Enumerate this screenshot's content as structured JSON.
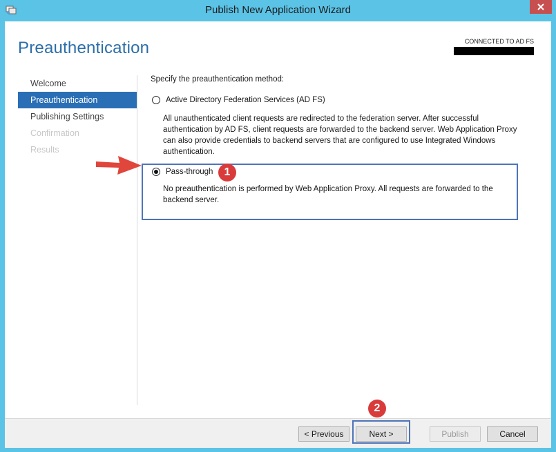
{
  "window": {
    "title": "Publish New Application Wizard",
    "icon": "wizard-app-icon"
  },
  "header": {
    "page_title": "Preauthentication",
    "connected_label": "CONNECTED TO AD FS"
  },
  "nav": {
    "items": [
      {
        "label": "Welcome",
        "state": "normal"
      },
      {
        "label": "Preauthentication",
        "state": "active"
      },
      {
        "label": "Publishing Settings",
        "state": "normal"
      },
      {
        "label": "Confirmation",
        "state": "disabled"
      },
      {
        "label": "Results",
        "state": "disabled"
      }
    ]
  },
  "content": {
    "prompt": "Specify the preauthentication method:",
    "option_adfs": {
      "label": "Active Directory Federation Services (AD FS)",
      "selected": false,
      "description_lines": [
        "All unauthenticated client requests are redirected to the federation server. After successful",
        "authentication by AD FS, client requests are forwarded to the backend server. Web Application Proxy",
        "can also provide credentials to backend servers that are configured to use Integrated Windows",
        "authentication."
      ]
    },
    "option_passthrough": {
      "label": "Pass-through",
      "selected": true,
      "description_lines": [
        "No preauthentication is performed by Web Application Proxy. All requests are forwarded to the",
        "backend server."
      ]
    }
  },
  "annotations": {
    "step1": "1",
    "step2": "2",
    "highlight_color": "#4d74b8",
    "badge_color": "#d93b3b",
    "arrow_color": "#e0463c"
  },
  "footer": {
    "previous_label": "< Previous",
    "next_label": "Next >",
    "publish_label": "Publish",
    "cancel_label": "Cancel"
  }
}
